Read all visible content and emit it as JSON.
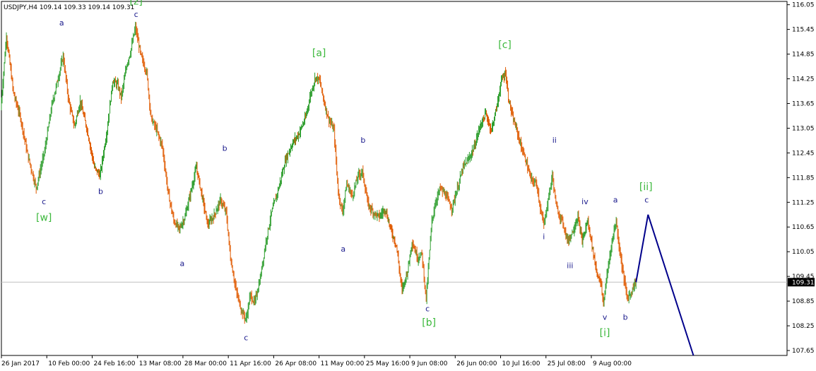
{
  "chart_data": {
    "type": "candlestick",
    "symbol_header": "USDJPY,H4  109.14 109.33 109.14 109.31",
    "current_price": 109.31,
    "current_price_label": "109.31",
    "ylim": [
      107.53,
      116.13
    ],
    "y_ticks": [
      {
        "value": 116.05,
        "label": "116.05"
      },
      {
        "value": 115.45,
        "label": "115.45"
      },
      {
        "value": 114.85,
        "label": "114.85"
      },
      {
        "value": 114.25,
        "label": "114.25"
      },
      {
        "value": 113.65,
        "label": "113.65"
      },
      {
        "value": 113.05,
        "label": "113.05"
      },
      {
        "value": 112.45,
        "label": "112.45"
      },
      {
        "value": 111.85,
        "label": "111.85"
      },
      {
        "value": 111.25,
        "label": "111.25"
      },
      {
        "value": 110.65,
        "label": "110.65"
      },
      {
        "value": 110.05,
        "label": "110.05"
      },
      {
        "value": 109.45,
        "label": "109.45"
      },
      {
        "value": 108.85,
        "label": "108.85"
      },
      {
        "value": 108.25,
        "label": "108.25"
      },
      {
        "value": 107.65,
        "label": "107.65"
      }
    ],
    "x_ticks": [
      {
        "t": 0,
        "label": "26 Jan 2017"
      },
      {
        "t": 64,
        "label": "10 Feb 00:00"
      },
      {
        "t": 128,
        "label": "24 Feb 16:00"
      },
      {
        "t": 192,
        "label": "13 Mar 08:00"
      },
      {
        "t": 256,
        "label": "28 Mar 00:00"
      },
      {
        "t": 320,
        "label": "11 Apr 16:00"
      },
      {
        "t": 384,
        "label": "26 Apr 08:00"
      },
      {
        "t": 448,
        "label": "11 May 00:00"
      },
      {
        "t": 512,
        "label": "25 May 16:00"
      },
      {
        "t": 576,
        "label": "9 Jun 08:00"
      },
      {
        "t": 640,
        "label": "26 Jun 00:00"
      },
      {
        "t": 704,
        "label": "10 Jul 16:00"
      },
      {
        "t": 768,
        "label": "25 Jul 08:00"
      },
      {
        "t": 832,
        "label": "9 Aug 00:00"
      }
    ],
    "x_range": [
      0,
      1108
    ],
    "price_path": [
      [
        0,
        113.5
      ],
      [
        8,
        115.3
      ],
      [
        18,
        113.9
      ],
      [
        28,
        113.3
      ],
      [
        38,
        112.4
      ],
      [
        50,
        111.6
      ],
      [
        62,
        112.5
      ],
      [
        72,
        113.6
      ],
      [
        80,
        114.2
      ],
      [
        88,
        114.8
      ],
      [
        96,
        113.7
      ],
      [
        104,
        113.1
      ],
      [
        112,
        113.7
      ],
      [
        122,
        113.0
      ],
      [
        132,
        112.1
      ],
      [
        140,
        111.9
      ],
      [
        150,
        113.0
      ],
      [
        158,
        114.2
      ],
      [
        165,
        114.1
      ],
      [
        170,
        113.8
      ],
      [
        178,
        114.6
      ],
      [
        183,
        114.9
      ],
      [
        190,
        115.5
      ],
      [
        198,
        114.8
      ],
      [
        206,
        114.4
      ],
      [
        212,
        113.3
      ],
      [
        220,
        113.0
      ],
      [
        228,
        112.6
      ],
      [
        236,
        111.5
      ],
      [
        244,
        110.8
      ],
      [
        252,
        110.6
      ],
      [
        260,
        110.9
      ],
      [
        268,
        111.5
      ],
      [
        276,
        112.1
      ],
      [
        284,
        111.4
      ],
      [
        292,
        110.7
      ],
      [
        300,
        110.9
      ],
      [
        310,
        111.3
      ],
      [
        318,
        111.0
      ],
      [
        324,
        109.9
      ],
      [
        332,
        109.1
      ],
      [
        340,
        108.6
      ],
      [
        346,
        108.4
      ],
      [
        352,
        109.0
      ],
      [
        358,
        108.8
      ],
      [
        366,
        109.4
      ],
      [
        374,
        110.3
      ],
      [
        382,
        111.0
      ],
      [
        392,
        111.6
      ],
      [
        402,
        112.3
      ],
      [
        412,
        112.7
      ],
      [
        420,
        112.9
      ],
      [
        430,
        113.3
      ],
      [
        436,
        113.8
      ],
      [
        444,
        114.3
      ],
      [
        450,
        114.2
      ],
      [
        456,
        113.7
      ],
      [
        462,
        113.3
      ],
      [
        470,
        113.0
      ],
      [
        476,
        111.5
      ],
      [
        482,
        111.0
      ],
      [
        488,
        111.7
      ],
      [
        496,
        111.4
      ],
      [
        504,
        111.9
      ],
      [
        510,
        112.0
      ],
      [
        518,
        111.2
      ],
      [
        526,
        111.0
      ],
      [
        534,
        110.9
      ],
      [
        542,
        111.1
      ],
      [
        550,
        110.6
      ],
      [
        558,
        110.2
      ],
      [
        566,
        109.1
      ],
      [
        574,
        109.6
      ],
      [
        580,
        110.3
      ],
      [
        588,
        109.9
      ],
      [
        594,
        110.0
      ],
      [
        600,
        108.9
      ],
      [
        608,
        110.8
      ],
      [
        614,
        111.3
      ],
      [
        620,
        111.6
      ],
      [
        628,
        111.4
      ],
      [
        636,
        111.1
      ],
      [
        646,
        111.7
      ],
      [
        652,
        112.1
      ],
      [
        660,
        112.3
      ],
      [
        668,
        112.6
      ],
      [
        676,
        113.1
      ],
      [
        684,
        113.4
      ],
      [
        692,
        113.0
      ],
      [
        700,
        113.6
      ],
      [
        706,
        114.2
      ],
      [
        712,
        114.4
      ],
      [
        716,
        113.8
      ],
      [
        722,
        113.3
      ],
      [
        728,
        113.0
      ],
      [
        734,
        112.6
      ],
      [
        740,
        112.3
      ],
      [
        748,
        111.8
      ],
      [
        756,
        111.7
      ],
      [
        762,
        111.0
      ],
      [
        766,
        110.7
      ],
      [
        772,
        111.3
      ],
      [
        778,
        111.9
      ],
      [
        784,
        111.1
      ],
      [
        792,
        110.8
      ],
      [
        800,
        110.3
      ],
      [
        808,
        110.6
      ],
      [
        814,
        110.9
      ],
      [
        820,
        110.3
      ],
      [
        828,
        110.8
      ],
      [
        834,
        110.2
      ],
      [
        840,
        109.6
      ],
      [
        846,
        109.3
      ],
      [
        850,
        108.8
      ],
      [
        856,
        109.6
      ],
      [
        862,
        110.3
      ],
      [
        868,
        110.8
      ],
      [
        872,
        110.2
      ],
      [
        878,
        109.5
      ],
      [
        884,
        108.9
      ],
      [
        890,
        109.1
      ],
      [
        895,
        109.3
      ]
    ],
    "projection": [
      [
        895,
        109.31
      ],
      [
        912,
        110.95
      ],
      [
        976,
        107.53
      ]
    ],
    "wave_labels": [
      {
        "text": "[z]",
        "t": 190,
        "p": 116.05,
        "color": "green"
      },
      {
        "text": "a",
        "t": 85,
        "p": 115.55,
        "color": "blue"
      },
      {
        "text": "c",
        "t": 190,
        "p": 115.75,
        "color": "blue"
      },
      {
        "text": "[a]",
        "t": 448,
        "p": 114.8,
        "color": "green"
      },
      {
        "text": "[c]",
        "t": 710,
        "p": 115.0,
        "color": "green"
      },
      {
        "text": "c",
        "t": 60,
        "p": 111.2,
        "color": "blue"
      },
      {
        "text": "[w]",
        "t": 60,
        "p": 110.8,
        "color": "green"
      },
      {
        "text": "b",
        "t": 140,
        "p": 111.45,
        "color": "blue"
      },
      {
        "text": "b",
        "t": 315,
        "p": 112.5,
        "color": "blue"
      },
      {
        "text": "a",
        "t": 255,
        "p": 109.7,
        "color": "blue"
      },
      {
        "text": "c",
        "t": 345,
        "p": 107.9,
        "color": "blue"
      },
      {
        "text": "b",
        "t": 510,
        "p": 112.7,
        "color": "blue"
      },
      {
        "text": "a",
        "t": 482,
        "p": 110.05,
        "color": "blue"
      },
      {
        "text": "c",
        "t": 601,
        "p": 108.6,
        "color": "blue"
      },
      {
        "text": "[b]",
        "t": 603,
        "p": 108.25,
        "color": "green"
      },
      {
        "text": "ii",
        "t": 780,
        "p": 112.7,
        "color": "blue"
      },
      {
        "text": "i",
        "t": 765,
        "p": 110.35,
        "color": "blue"
      },
      {
        "text": "iv",
        "t": 823,
        "p": 111.2,
        "color": "blue"
      },
      {
        "text": "iii",
        "t": 802,
        "p": 109.65,
        "color": "blue"
      },
      {
        "text": "a",
        "t": 866,
        "p": 111.25,
        "color": "blue"
      },
      {
        "text": "v",
        "t": 851,
        "p": 108.4,
        "color": "blue"
      },
      {
        "text": "[i]",
        "t": 851,
        "p": 108.0,
        "color": "green"
      },
      {
        "text": "b",
        "t": 880,
        "p": 108.4,
        "color": "blue"
      },
      {
        "text": "[ii]",
        "t": 909,
        "p": 111.55,
        "color": "green"
      },
      {
        "text": "c",
        "t": 910,
        "p": 111.25,
        "color": "blue"
      }
    ],
    "colors": {
      "up_candle": "#2e9e2e",
      "down_candle": "#e05a00",
      "projection_line": "#00008b",
      "price_tag_bg": "#000000",
      "current_line": "#c0c0c0",
      "wave_blue": "#1a1a8c",
      "wave_green": "#3cb83c"
    },
    "grid": false
  }
}
